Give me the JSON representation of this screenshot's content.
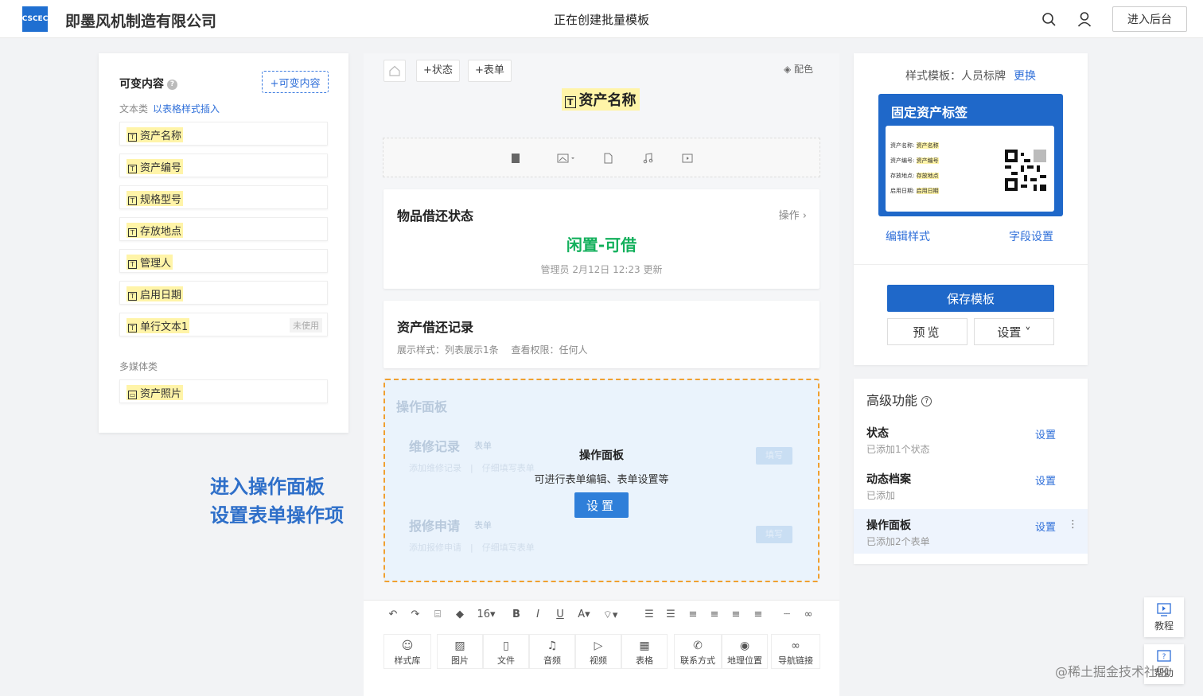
{
  "header": {
    "logo_text": "CSCEC",
    "company": "即墨风机制造有限公司",
    "title": "正在创建批量模板",
    "enter_label": "进入后台",
    "icons": [
      "search-icon",
      "user-icon"
    ]
  },
  "left_panel": {
    "title": "可变内容",
    "add_label": "+可变内容",
    "text_section_label": "文本类",
    "text_section_link": "以表格样式插入",
    "text_items": [
      {
        "label": "资产名称",
        "badge": ""
      },
      {
        "label": "资产编号",
        "badge": ""
      },
      {
        "label": "规格型号",
        "badge": ""
      },
      {
        "label": "存放地点",
        "badge": ""
      },
      {
        "label": "管理人",
        "badge": ""
      },
      {
        "label": "启用日期",
        "badge": ""
      },
      {
        "label": "单行文本1",
        "badge": "未使用"
      }
    ],
    "media_section_label": "多媒体类",
    "media_items": [
      {
        "label": "资产照片"
      }
    ]
  },
  "promo": {
    "line1": "进入操作面板",
    "line2": "设置表单操作项"
  },
  "center": {
    "status_btn": "+状态",
    "form_btn": "+表单",
    "color_label": "配色",
    "asset_title": "资产名称",
    "borrow_card": {
      "title": "物品借还状态",
      "op_link": "操作 ›",
      "status": "闲置-可借",
      "sub": "管理员 2月12日 12:23 更新"
    },
    "record_card": {
      "title": "资产借还记录",
      "sub": "展示样式：列表展示1条　 查看权限：任何人"
    },
    "op_panel": {
      "ghost_title": "操作面板",
      "ghost_item1": "维修记录",
      "ghost_item1_tag": "表单",
      "ghost_item1_sub": "添加维修记录　|　仔细填写表单",
      "ghost_item2": "报修申请",
      "ghost_item2_tag": "表单",
      "ghost_item2_sub": "添加报修申请　|　仔细填写表单",
      "ghost_btn": "填写",
      "title": "操作面板",
      "desc": "可进行表单编辑、表单设置等",
      "set_label": "设置"
    },
    "editor": {
      "font_size": "16",
      "tools": [
        {
          "label": "样式库",
          "icon": "palette-icon"
        },
        {
          "label": "图片",
          "icon": "image-icon"
        },
        {
          "label": "文件",
          "icon": "file-icon"
        },
        {
          "label": "音频",
          "icon": "music-icon"
        },
        {
          "label": "视频",
          "icon": "video-icon"
        },
        {
          "label": "表格",
          "icon": "table-icon"
        },
        {
          "label": "联系方式",
          "icon": "phone-icon"
        },
        {
          "label": "地理位置",
          "icon": "location-icon"
        },
        {
          "label": "导航链接",
          "icon": "link-icon"
        }
      ]
    }
  },
  "right_panel": {
    "style_label": "样式模板：人员标牌",
    "change_link": "更换",
    "tag": {
      "title": "固定资产标签",
      "lines": [
        {
          "key": "资产名称:",
          "val": "资产名称"
        },
        {
          "key": "资产编号:",
          "val": "资产编号"
        },
        {
          "key": "存放地点:",
          "val": "存放地点"
        },
        {
          "key": "启用日期:",
          "val": "启用日期"
        }
      ]
    },
    "edit_style": "编辑样式",
    "field_settings": "字段设置",
    "save_label": "保存模板",
    "preview_label": "预览",
    "settings_label": "设置 ˅"
  },
  "advanced": {
    "title": "高级功能",
    "rows": [
      {
        "name": "状态",
        "desc": "已添加1个状态",
        "link": "设置"
      },
      {
        "name": "动态档案",
        "desc": "已添加",
        "link": "设置"
      },
      {
        "name": "操作面板",
        "desc": "已添加2个表单",
        "link": "设置"
      }
    ]
  },
  "float": {
    "tutorial": "教程",
    "help": "帮助"
  },
  "watermark": "@稀土掘金技术社区",
  "colors": {
    "primary": "#1f68c9",
    "link": "#2f6fd9",
    "success": "#13b05c",
    "highlight": "#fff4a8",
    "dashed_border": "#f0a030"
  }
}
